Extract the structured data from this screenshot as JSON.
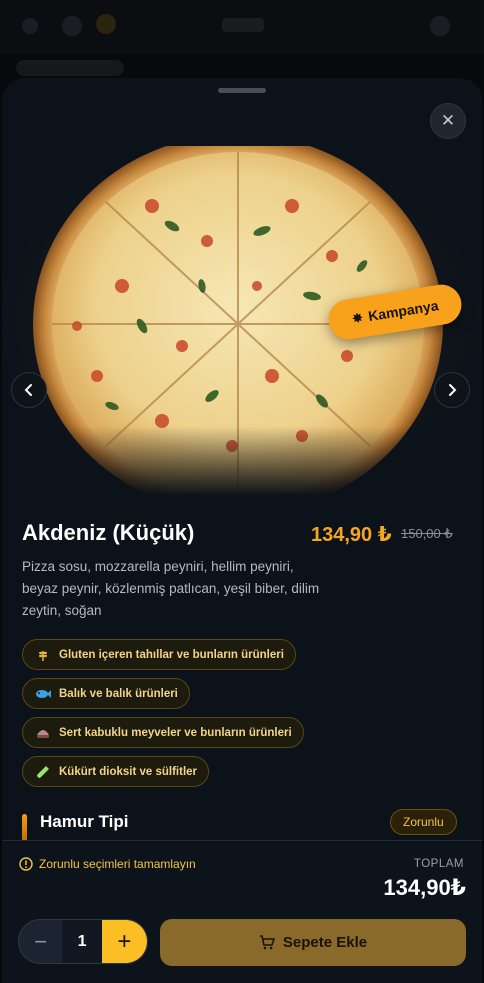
{
  "product": {
    "name": "Akdeniz (Küçük)",
    "price": "134,90 ₺",
    "old_price": "150,00 ₺",
    "description": "Pizza sosu, mozzarella peyniri, hellim peyniri, beyaz peynir, közlenmiş patlıcan, yeşil biber, dilim zeytin, soğan",
    "campaign_label": "Kampanya"
  },
  "gallery": {
    "slide_count": 3,
    "active_index": 0
  },
  "allergens": [
    {
      "label": "Gluten içeren tahıllar ve bunların ürünleri",
      "icon": "wheat-icon"
    },
    {
      "label": "Balık ve balık ürünleri",
      "icon": "fish-icon"
    },
    {
      "label": "Sert kabuklu meyveler ve bunların ürünleri",
      "icon": "nut-icon"
    },
    {
      "label": "Kükürt dioksit ve sülfitler",
      "icon": "test-tube-icon"
    }
  ],
  "options_section": {
    "title": "Hamur Tipi",
    "badge": "Zorunlu"
  },
  "footer": {
    "warning": "Zorunlu seçimleri tamamlayın",
    "total_label": "TOPLAM",
    "total_value": "134,90₺",
    "quantity": "1",
    "add_to_cart_label": "Sepete Ekle"
  },
  "colors": {
    "accent": "#f59e0b",
    "price": "#f5a623",
    "youtube": "#ff0000"
  }
}
